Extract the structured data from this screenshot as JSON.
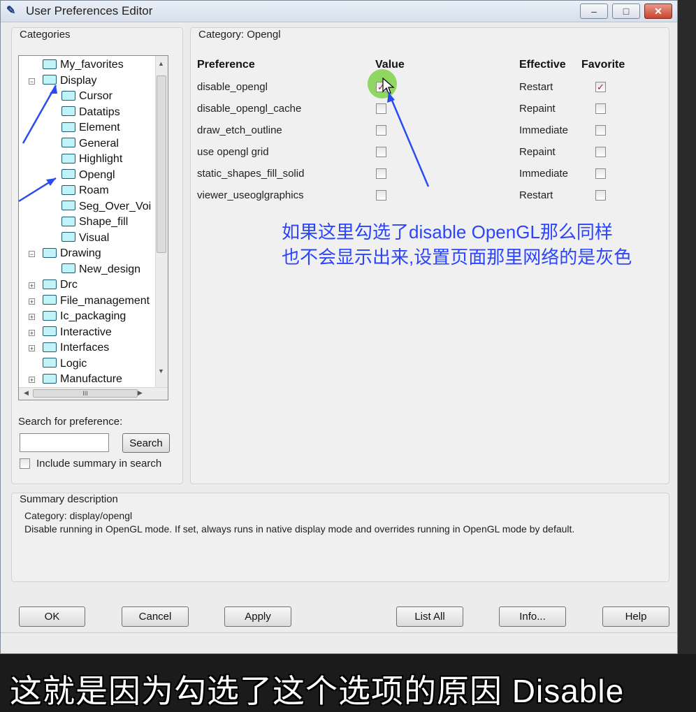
{
  "window": {
    "title": "User Preferences Editor",
    "min": "–",
    "max": "□",
    "close": "✕"
  },
  "categories": {
    "label": "Categories",
    "tree": [
      {
        "label": "My_favorites",
        "level": 1,
        "expander": ""
      },
      {
        "label": "Display",
        "level": 1,
        "expander": "−"
      },
      {
        "label": "Cursor",
        "level": 2,
        "expander": ""
      },
      {
        "label": "Datatips",
        "level": 2,
        "expander": ""
      },
      {
        "label": "Element",
        "level": 2,
        "expander": ""
      },
      {
        "label": "General",
        "level": 2,
        "expander": ""
      },
      {
        "label": "Highlight",
        "level": 2,
        "expander": ""
      },
      {
        "label": "Opengl",
        "level": 2,
        "expander": ""
      },
      {
        "label": "Roam",
        "level": 2,
        "expander": ""
      },
      {
        "label": "Seg_Over_Voi",
        "level": 2,
        "expander": ""
      },
      {
        "label": "Shape_fill",
        "level": 2,
        "expander": ""
      },
      {
        "label": "Visual",
        "level": 2,
        "expander": ""
      },
      {
        "label": "Drawing",
        "level": 1,
        "expander": "−"
      },
      {
        "label": "New_design",
        "level": 2,
        "expander": ""
      },
      {
        "label": "Drc",
        "level": 1,
        "expander": "+"
      },
      {
        "label": "File_management",
        "level": 1,
        "expander": "+"
      },
      {
        "label": "Ic_packaging",
        "level": 1,
        "expander": "+"
      },
      {
        "label": "Interactive",
        "level": 1,
        "expander": "+"
      },
      {
        "label": "Interfaces",
        "level": 1,
        "expander": "+"
      },
      {
        "label": "Logic",
        "level": 1,
        "expander": ""
      },
      {
        "label": "Manufacture",
        "level": 1,
        "expander": "+"
      }
    ],
    "hscroll_thumb": "III"
  },
  "search": {
    "label": "Search for preference:",
    "value": "",
    "button": "Search",
    "include_summary": "Include summary in search",
    "include_checked": false
  },
  "category_panel": {
    "label": "Category:  Opengl",
    "headers": {
      "preference": "Preference",
      "value": "Value",
      "effective": "Effective",
      "favorite": "Favorite"
    },
    "rows": [
      {
        "name": "disable_opengl",
        "value": true,
        "effective": "Restart",
        "favorite": true
      },
      {
        "name": "disable_opengl_cache",
        "value": false,
        "effective": "Repaint",
        "favorite": false
      },
      {
        "name": "draw_etch_outline",
        "value": false,
        "effective": "Immediate",
        "favorite": false
      },
      {
        "name": "use opengl grid",
        "value": false,
        "effective": "Repaint",
        "favorite": false
      },
      {
        "name": "static_shapes_fill_solid",
        "value": false,
        "effective": "Immediate",
        "favorite": false
      },
      {
        "name": "viewer_useoglgraphics",
        "value": false,
        "effective": "Restart",
        "favorite": false
      }
    ]
  },
  "annotation": {
    "line1": "如果这里勾选了disable OpenGL那么同样",
    "line2": "也不会显示出来,设置页面那里网络的是灰色"
  },
  "summary": {
    "label": "Summary description",
    "line1": "Category: display/opengl",
    "line2": "Disable running in OpenGL mode. If set, always runs in native display mode and overrides running in OpenGL mode by default."
  },
  "buttons": {
    "ok": "OK",
    "cancel": "Cancel",
    "apply": "Apply",
    "list_all": "List All",
    "info": "Info...",
    "help": "Help"
  },
  "subtitle": "这就是因为勾选了这个选项的原因 Disable",
  "colors": {
    "annotation": "#2b44ff",
    "arrow": "#2a4bf0",
    "highlight": "#7fd14a"
  }
}
